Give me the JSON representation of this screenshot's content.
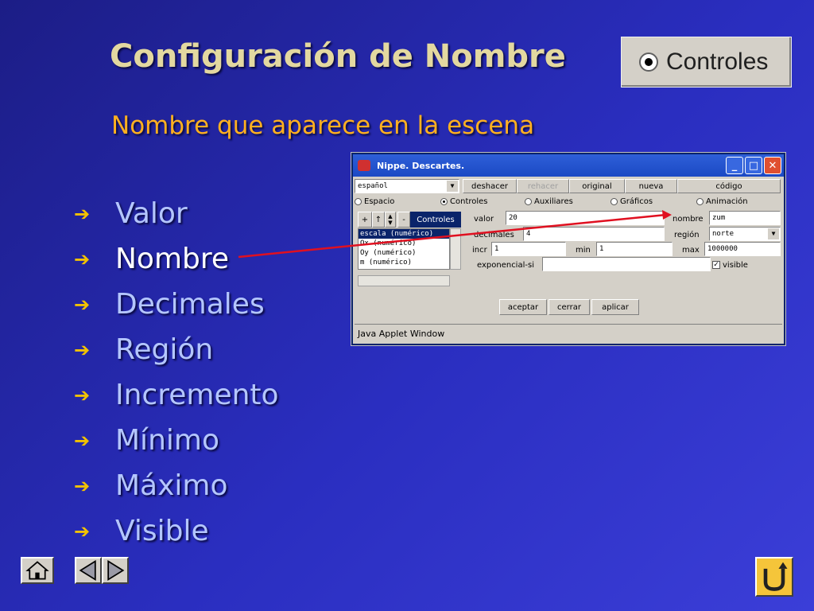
{
  "slide": {
    "title": "Configuración de Nombre",
    "subtitle": "Nombre que aparece en la escena",
    "controls_button_label": "Controles",
    "bullets": [
      "Valor",
      "Nombre",
      "Decimales",
      "Región",
      "Incremento",
      "Mínimo",
      "Máximo",
      "Visible"
    ],
    "active_bullet": "Nombre"
  },
  "applet": {
    "window_title": "Nippe. Descartes.",
    "status_text": "Java Applet Window",
    "language": "español",
    "toolbar": {
      "undo": "deshacer",
      "redo": "rehacer",
      "original": "original",
      "new": "nueva",
      "code": "código"
    },
    "tabs": {
      "space": "Espacio",
      "controls": "Controles",
      "auxiliaries": "Auxiliares",
      "graphics": "Gráficos",
      "animation": "Animación",
      "selected": "Controles"
    },
    "list_panel": {
      "add": "+",
      "up": "↑",
      "remove": "-",
      "header": "Controles",
      "items": [
        "escala (numérico)",
        "Ox (numérico)",
        "Oy (numérico)",
        "m (numérico)"
      ],
      "selected_item": "escala (numérico)"
    },
    "fields": {
      "valor_label": "valor",
      "valor": "20",
      "nombre_label": "nombre",
      "nombre": "zum",
      "decimales_label": "decimales",
      "decimales": "4",
      "region_label": "región",
      "region": "norte",
      "incr_label": "incr",
      "incr": "1",
      "min_label": "min",
      "min": "1",
      "max_label": "max",
      "max": "1000000",
      "exponencial_label": "exponencial-si",
      "exponencial": "",
      "visible_label": "visible",
      "visible_checked": true
    },
    "actions": {
      "accept": "aceptar",
      "close": "cerrar",
      "apply": "aplicar"
    }
  },
  "colors": {
    "background": "#2a2ec0",
    "title": "#e3d8a0",
    "subtitle": "#ffb020",
    "bullet_text": "#b4c6ff",
    "bullet_arrow": "#f2c200",
    "active_bullet": "#ffffff",
    "pointer_line": "#e01020"
  },
  "icons": {
    "bullet": "arrow-right-icon",
    "home": "home-icon",
    "prev": "triangle-left-icon",
    "next": "triangle-right-icon",
    "back": "u-turn-arrow-icon"
  }
}
